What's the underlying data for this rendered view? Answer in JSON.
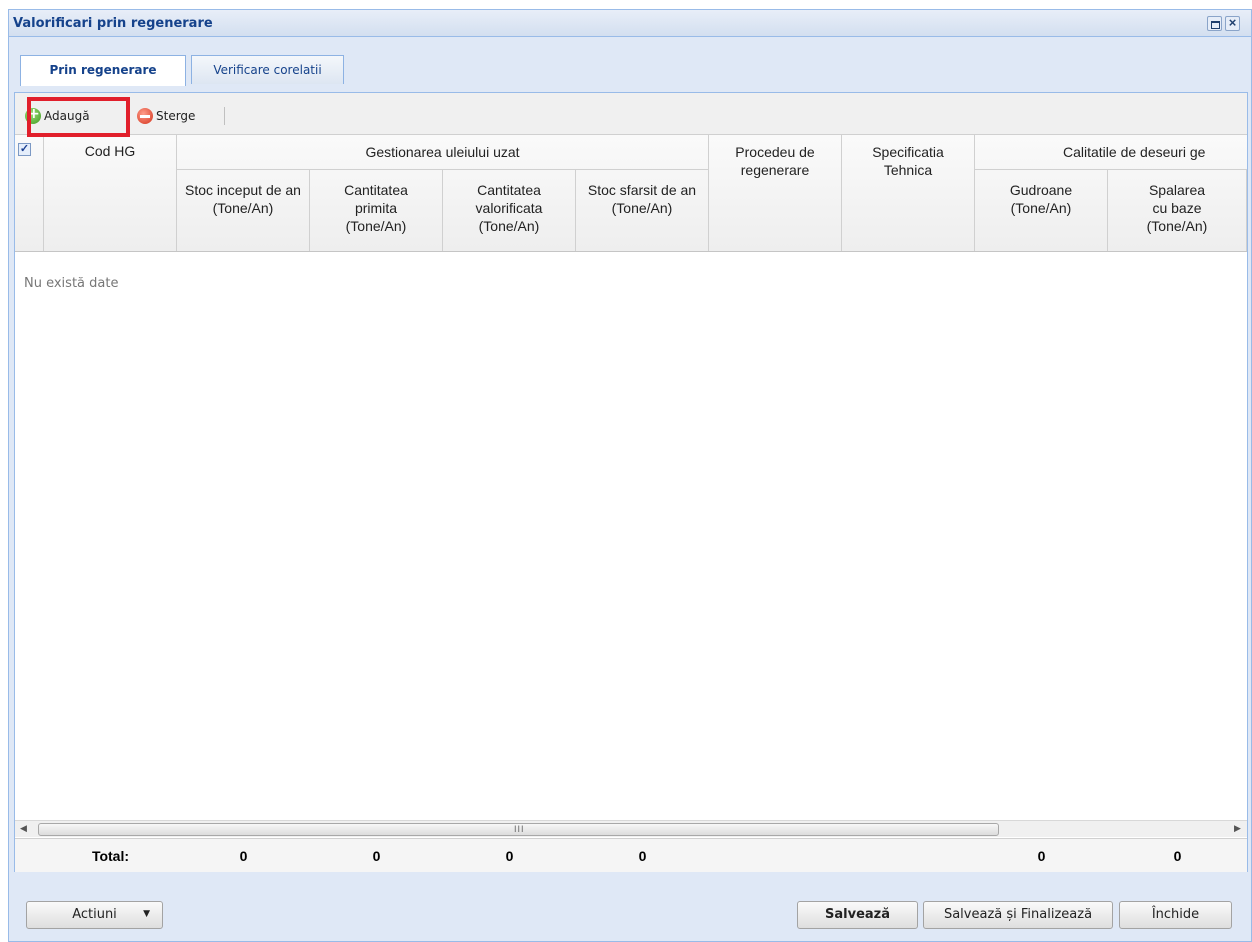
{
  "window": {
    "title": "Valorificari prin regenerare"
  },
  "tabs": [
    {
      "label": "Prin regenerare",
      "active": true
    },
    {
      "label": "Verificare corelatii",
      "active": false
    }
  ],
  "toolbar": {
    "add_label": "Adaugă",
    "delete_label": "Sterge"
  },
  "grid": {
    "headers": {
      "select_all_checked": true,
      "cod_hg": "Cod HG",
      "group_oil": "Gestionarea uleiului uzat",
      "stoc_inceput": "Stoc inceput de an (Tone/An)",
      "cant_primita": "Cantitatea primita (Tone/An)",
      "cant_valorificata": "Cantitatea valorificata (Tone/An)",
      "stoc_sfarsit": "Stoc sfarsit de an (Tone/An)",
      "procedeu": "Procedeu de regenerare",
      "specificatia": "Specificatia Tehnica",
      "group_waste": "Calitatile de deseuri ge",
      "gudroane": "Gudroane (Tone/An)",
      "spalarea": "Spalarea cu baze (Tone/An)"
    },
    "empty_text": "Nu există date",
    "totals": {
      "label": "Total:",
      "stoc_inceput": "0",
      "cant_primita": "0",
      "cant_valorificata": "0",
      "stoc_sfarsit": "0",
      "gudroane": "0",
      "spalarea": "0"
    }
  },
  "footer": {
    "actions_label": "Actiuni",
    "save_label": "Salvează",
    "save_finalize_label": "Salvează și Finalizează",
    "close_label": "Închide"
  },
  "colors": {
    "highlight": "#e11f2b",
    "title": "#15428b"
  }
}
